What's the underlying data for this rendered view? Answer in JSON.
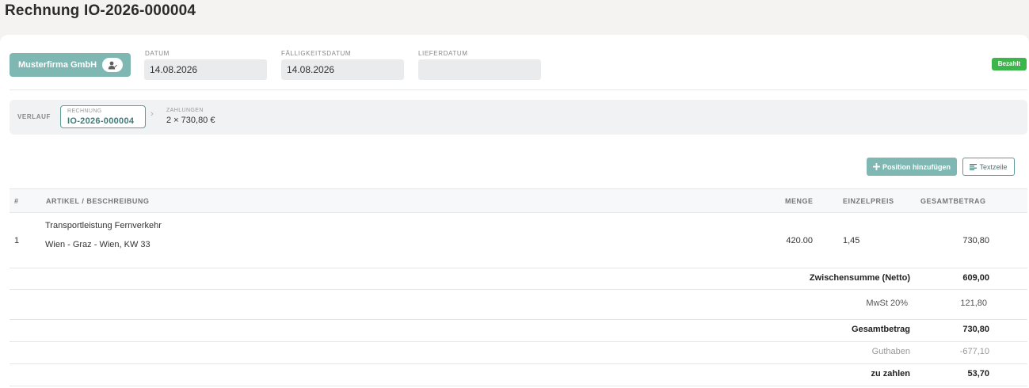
{
  "page": {
    "title": "Rechnung IO-2026-000004"
  },
  "header": {
    "client_name": "Musterfirma GmbH",
    "client_icon": "user-edit-icon",
    "date_label": "DATUM",
    "date_value": "14.08.2026",
    "due_label": "FÄLLIGKEITSDATUM",
    "due_value": "14.08.2026",
    "delivery_label": "LIEFERDATUM",
    "delivery_value": "",
    "status_badge": "Bezahlt",
    "status_color": "#3cb54a"
  },
  "history": {
    "label": "VERLAUF",
    "invoice_label": "RECHNUNG",
    "invoice_number": "IO-2026-000004",
    "separator": "›",
    "payments_label": "ZAHLUNGEN",
    "payments_value": "2 × 730,80 €"
  },
  "toolbar": {
    "add_position_label": "Position hinzufügen",
    "add_icon": "plus-icon",
    "textline_label": "Textzeile",
    "textline_icon": "text-lines-icon"
  },
  "table": {
    "headers": {
      "index": "#",
      "article": "ARTIKEL / BESCHREIBUNG",
      "quantity": "MENGE",
      "unit_price": "EINZELPREIS",
      "total": "GESAMTBETRAG"
    },
    "rows": [
      {
        "index": "1",
        "title": "Transportleistung Fernverkehr",
        "description": "Wien - Graz - Wien, KW 33",
        "quantity": "420.00",
        "unit_price": "1,45",
        "total": "730,80"
      }
    ]
  },
  "summary": {
    "subtotal_label": "Zwischensumme (Netto)",
    "subtotal_value": "609,00",
    "vat_label": "MwSt 20%",
    "vat_value": "121,80",
    "total_label": "Gesamtbetrag",
    "total_value": "730,80",
    "credit_label": "Guthaben",
    "credit_value": "-677,10",
    "due_label": "zu zahlen",
    "due_value": "53,70"
  },
  "colors": {
    "accent": "#7fb7b2",
    "accent_dark": "#3d7d78",
    "paid": "#3cb54a"
  }
}
